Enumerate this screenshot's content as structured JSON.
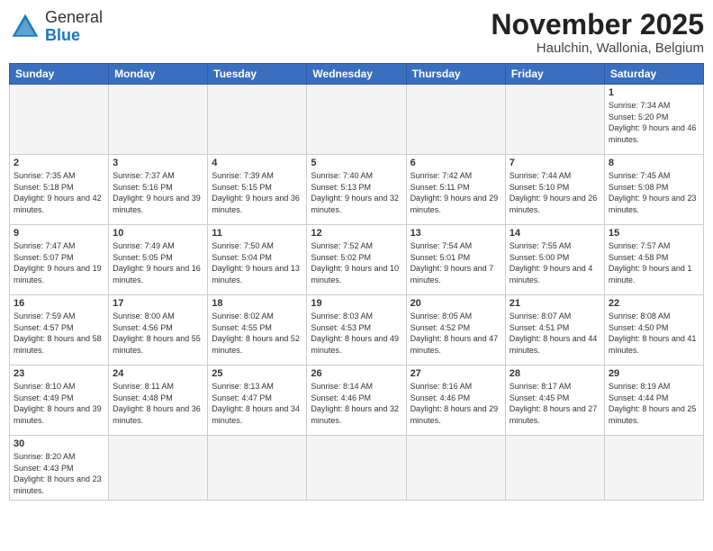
{
  "header": {
    "logo_general": "General",
    "logo_blue": "Blue",
    "title": "November 2025",
    "subtitle": "Haulchin, Wallonia, Belgium"
  },
  "weekdays": [
    "Sunday",
    "Monday",
    "Tuesday",
    "Wednesday",
    "Thursday",
    "Friday",
    "Saturday"
  ],
  "days": {
    "d1": {
      "n": "1",
      "sr": "7:34 AM",
      "ss": "5:20 PM",
      "dl": "9 hours and 46 minutes."
    },
    "d2": {
      "n": "2",
      "sr": "7:35 AM",
      "ss": "5:18 PM",
      "dl": "9 hours and 42 minutes."
    },
    "d3": {
      "n": "3",
      "sr": "7:37 AM",
      "ss": "5:16 PM",
      "dl": "9 hours and 39 minutes."
    },
    "d4": {
      "n": "4",
      "sr": "7:39 AM",
      "ss": "5:15 PM",
      "dl": "9 hours and 36 minutes."
    },
    "d5": {
      "n": "5",
      "sr": "7:40 AM",
      "ss": "5:13 PM",
      "dl": "9 hours and 32 minutes."
    },
    "d6": {
      "n": "6",
      "sr": "7:42 AM",
      "ss": "5:11 PM",
      "dl": "9 hours and 29 minutes."
    },
    "d7": {
      "n": "7",
      "sr": "7:44 AM",
      "ss": "5:10 PM",
      "dl": "9 hours and 26 minutes."
    },
    "d8": {
      "n": "8",
      "sr": "7:45 AM",
      "ss": "5:08 PM",
      "dl": "9 hours and 23 minutes."
    },
    "d9": {
      "n": "9",
      "sr": "7:47 AM",
      "ss": "5:07 PM",
      "dl": "9 hours and 19 minutes."
    },
    "d10": {
      "n": "10",
      "sr": "7:49 AM",
      "ss": "5:05 PM",
      "dl": "9 hours and 16 minutes."
    },
    "d11": {
      "n": "11",
      "sr": "7:50 AM",
      "ss": "5:04 PM",
      "dl": "9 hours and 13 minutes."
    },
    "d12": {
      "n": "12",
      "sr": "7:52 AM",
      "ss": "5:02 PM",
      "dl": "9 hours and 10 minutes."
    },
    "d13": {
      "n": "13",
      "sr": "7:54 AM",
      "ss": "5:01 PM",
      "dl": "9 hours and 7 minutes."
    },
    "d14": {
      "n": "14",
      "sr": "7:55 AM",
      "ss": "5:00 PM",
      "dl": "9 hours and 4 minutes."
    },
    "d15": {
      "n": "15",
      "sr": "7:57 AM",
      "ss": "4:58 PM",
      "dl": "9 hours and 1 minute."
    },
    "d16": {
      "n": "16",
      "sr": "7:59 AM",
      "ss": "4:57 PM",
      "dl": "8 hours and 58 minutes."
    },
    "d17": {
      "n": "17",
      "sr": "8:00 AM",
      "ss": "4:56 PM",
      "dl": "8 hours and 55 minutes."
    },
    "d18": {
      "n": "18",
      "sr": "8:02 AM",
      "ss": "4:55 PM",
      "dl": "8 hours and 52 minutes."
    },
    "d19": {
      "n": "19",
      "sr": "8:03 AM",
      "ss": "4:53 PM",
      "dl": "8 hours and 49 minutes."
    },
    "d20": {
      "n": "20",
      "sr": "8:05 AM",
      "ss": "4:52 PM",
      "dl": "8 hours and 47 minutes."
    },
    "d21": {
      "n": "21",
      "sr": "8:07 AM",
      "ss": "4:51 PM",
      "dl": "8 hours and 44 minutes."
    },
    "d22": {
      "n": "22",
      "sr": "8:08 AM",
      "ss": "4:50 PM",
      "dl": "8 hours and 41 minutes."
    },
    "d23": {
      "n": "23",
      "sr": "8:10 AM",
      "ss": "4:49 PM",
      "dl": "8 hours and 39 minutes."
    },
    "d24": {
      "n": "24",
      "sr": "8:11 AM",
      "ss": "4:48 PM",
      "dl": "8 hours and 36 minutes."
    },
    "d25": {
      "n": "25",
      "sr": "8:13 AM",
      "ss": "4:47 PM",
      "dl": "8 hours and 34 minutes."
    },
    "d26": {
      "n": "26",
      "sr": "8:14 AM",
      "ss": "4:46 PM",
      "dl": "8 hours and 32 minutes."
    },
    "d27": {
      "n": "27",
      "sr": "8:16 AM",
      "ss": "4:46 PM",
      "dl": "8 hours and 29 minutes."
    },
    "d28": {
      "n": "28",
      "sr": "8:17 AM",
      "ss": "4:45 PM",
      "dl": "8 hours and 27 minutes."
    },
    "d29": {
      "n": "29",
      "sr": "8:19 AM",
      "ss": "4:44 PM",
      "dl": "8 hours and 25 minutes."
    },
    "d30": {
      "n": "30",
      "sr": "8:20 AM",
      "ss": "4:43 PM",
      "dl": "8 hours and 23 minutes."
    }
  },
  "labels": {
    "sunrise": "Sunrise:",
    "sunset": "Sunset:",
    "daylight": "Daylight:"
  }
}
